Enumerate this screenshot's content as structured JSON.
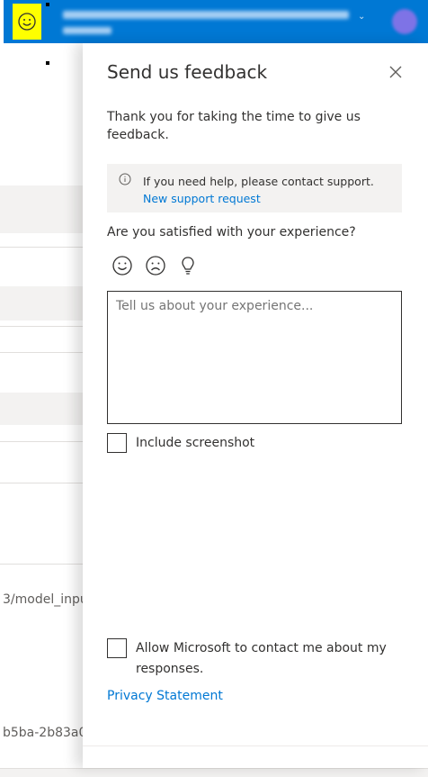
{
  "topbar": {
    "bg_color": "#0078d4",
    "feedback_icon": "smiley-icon",
    "chevron": "⌄",
    "account_icon": "avatar"
  },
  "background": {
    "path_fragment": "3/model_inpu",
    "id_fragment": "b5ba-2b83a0"
  },
  "panel": {
    "title": "Send us feedback",
    "close_icon": "close-icon",
    "intro": "Thank you for taking the time to give us feedback.",
    "info": {
      "icon": "info-icon",
      "text": "If you need help, please contact support.",
      "link": "New support request"
    },
    "question": "Are you satisfied with your experience?",
    "rating_icons": [
      "smile-icon",
      "frown-icon",
      "lightbulb-icon"
    ],
    "textarea_placeholder": "Tell us about your experience...",
    "include_screenshot": {
      "label": "Include screenshot",
      "checked": false
    },
    "allow_contact": {
      "label": "Allow Microsoft to contact me about my responses.",
      "checked": false
    },
    "privacy_link": "Privacy Statement",
    "link_color": "#0078d4"
  }
}
